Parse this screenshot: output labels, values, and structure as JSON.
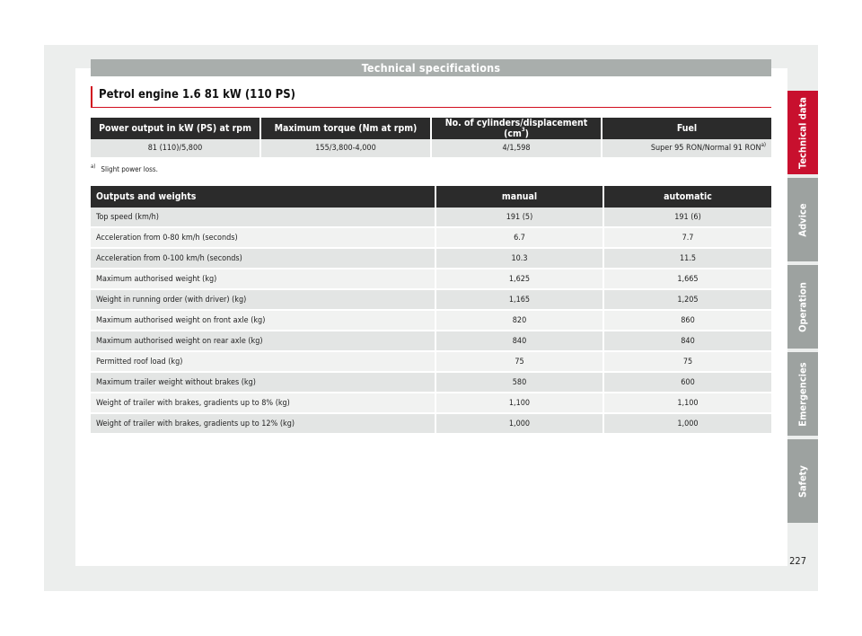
{
  "header": {
    "title": "Technical specifications"
  },
  "section": {
    "title": "Petrol engine 1.6 81 kW (110 PS)"
  },
  "engine_table": {
    "headers": [
      "Power output in kW (PS) at rpm",
      "Maximum torque (Nm at rpm)",
      "No. of cylinders/displacement (cm",
      "Fuel"
    ],
    "header_sup": "3",
    "header_close": ")",
    "row": [
      "81 (110)/5,800",
      "155/3,800-4,000",
      "4/1,598",
      "Super 95 RON/Normal 91 RON"
    ],
    "row_sup": "a)"
  },
  "footnote": {
    "marker": "a)",
    "text": "Slight power loss."
  },
  "outputs_table": {
    "headers": [
      "Outputs and weights",
      "manual",
      "automatic"
    ],
    "rows": [
      [
        "Top speed (km/h)",
        "191 (5)",
        "191 (6)"
      ],
      [
        "Acceleration from 0-80 km/h (seconds)",
        "6.7",
        "7.7"
      ],
      [
        "Acceleration from 0-100 km/h (seconds)",
        "10.3",
        "11.5"
      ],
      [
        "Maximum authorised weight (kg)",
        "1,625",
        "1,665"
      ],
      [
        "Weight in running order (with driver) (kg)",
        "1,165",
        "1,205"
      ],
      [
        "Maximum authorised weight on front axle (kg)",
        "820",
        "860"
      ],
      [
        "Maximum authorised weight on rear axle (kg)",
        "840",
        "840"
      ],
      [
        "Permitted roof load (kg)",
        "75",
        "75"
      ],
      [
        "Maximum trailer weight without brakes (kg)",
        "580",
        "600"
      ],
      [
        "Weight of trailer with brakes, gradients up to 8% (kg)",
        "1,100",
        "1,100"
      ],
      [
        "Weight of trailer with brakes, gradients up to 12% (kg)",
        "1,000",
        "1,000"
      ]
    ]
  },
  "side_tabs": [
    {
      "label": "Technical data",
      "active": true
    },
    {
      "label": "Advice",
      "active": false
    },
    {
      "label": "Operation",
      "active": false
    },
    {
      "label": "Emergencies",
      "active": false
    },
    {
      "label": "Safety",
      "active": false
    }
  ],
  "page_number": "227",
  "colors": {
    "accent": "#c8102e",
    "header_bar": "#a9aeac",
    "table_header": "#2b2b2b",
    "tab_inactive": "#9da2a0"
  }
}
